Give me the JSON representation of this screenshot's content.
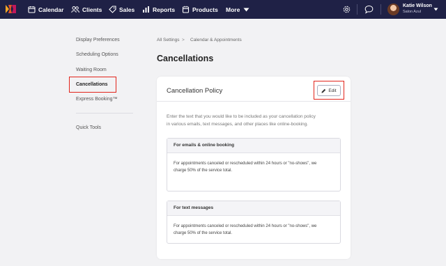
{
  "nav": {
    "items": [
      {
        "label": "Calendar"
      },
      {
        "label": "Clients"
      },
      {
        "label": "Sales"
      },
      {
        "label": "Reports"
      },
      {
        "label": "Products"
      },
      {
        "label": "More"
      }
    ],
    "user": {
      "name": "Katie Wilson",
      "business": "Salon Azul"
    },
    "brand_color": "#1f2146"
  },
  "sidebar": {
    "items": [
      {
        "label": "Display Preferences"
      },
      {
        "label": "Scheduling Options"
      },
      {
        "label": "Waiting Room"
      },
      {
        "label": "Cancellations"
      },
      {
        "label": "Express Booking™"
      }
    ],
    "tools_label": "Quick Tools"
  },
  "breadcrumb": {
    "root": "All Settings",
    "separator": ">",
    "current": "Calendar & Appointments"
  },
  "page": {
    "title": "Cancellations"
  },
  "card": {
    "title": "Cancellation Policy",
    "edit_label": "Edit",
    "intro_line1": "Enter the text that you would like to be included as your cancellation policy",
    "intro_line2": "in various emails, text messages, and other places like online-booking.",
    "sections": [
      {
        "heading": "For emails & online booking",
        "line1": "For appointments canceled or rescheduled within 24 hours or \"no-shows\", we",
        "line2": "charge 50% of the service total."
      },
      {
        "heading": "For text messages",
        "line1": "For appointments canceled or rescheduled within 24 hours or \"no-shows\", we",
        "line2": "charge 50% of the service total."
      }
    ]
  },
  "highlight_color": "#e2231a"
}
